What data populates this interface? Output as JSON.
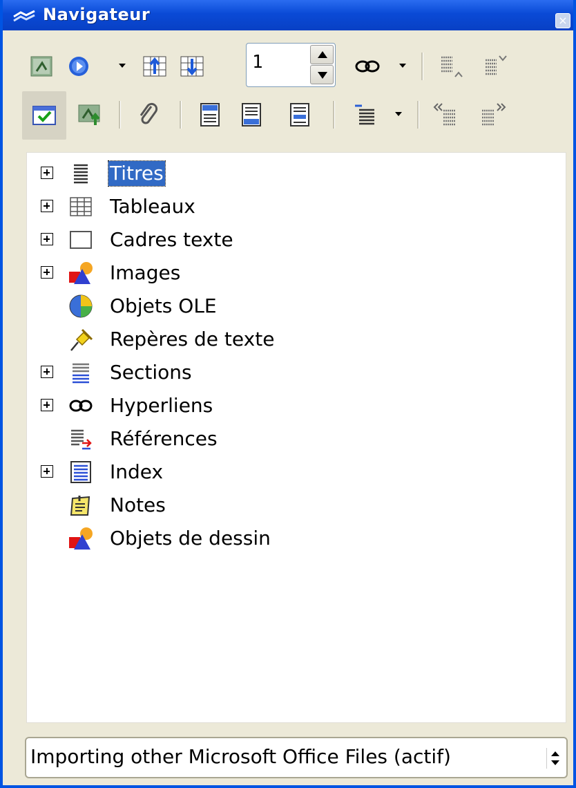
{
  "window": {
    "title": "Navigateur"
  },
  "toolbar": {
    "page_number": "1",
    "row1": [
      {
        "name": "navigation-icon"
      },
      {
        "name": "navigate-icon"
      },
      {
        "name": "previous-icon"
      },
      {
        "name": "next-icon"
      },
      {
        "name": "insert-hyperlink-icon"
      },
      {
        "name": "promote-level-icon"
      },
      {
        "name": "demote-level-icon"
      }
    ],
    "row2": [
      {
        "name": "content-view-toggle-icon"
      },
      {
        "name": "set-reminder-icon"
      },
      {
        "name": "paperclip-icon"
      },
      {
        "name": "header-icon"
      },
      {
        "name": "footer-icon"
      },
      {
        "name": "anchor-icon"
      },
      {
        "name": "heading-levels-icon"
      },
      {
        "name": "promote-chapter-icon"
      },
      {
        "name": "demote-chapter-icon"
      }
    ]
  },
  "tree": {
    "items": [
      {
        "label": "Titres",
        "icon": "headings-icon",
        "expandable": true,
        "selected": true
      },
      {
        "label": "Tableaux",
        "icon": "table-icon",
        "expandable": true
      },
      {
        "label": "Cadres texte",
        "icon": "frame-icon",
        "expandable": true
      },
      {
        "label": "Images",
        "icon": "image-icon",
        "expandable": true
      },
      {
        "label": "Objets OLE",
        "icon": "ole-object-icon",
        "expandable": false
      },
      {
        "label": "Repères de texte",
        "icon": "bookmark-pin-icon",
        "expandable": false
      },
      {
        "label": "Sections",
        "icon": "sections-icon",
        "expandable": true
      },
      {
        "label": "Hyperliens",
        "icon": "hyperlink-icon",
        "expandable": true
      },
      {
        "label": "Références",
        "icon": "references-icon",
        "expandable": false
      },
      {
        "label": "Index",
        "icon": "index-icon",
        "expandable": true
      },
      {
        "label": "Notes",
        "icon": "notes-icon",
        "expandable": false
      },
      {
        "label": "Objets de dessin",
        "icon": "drawing-objects-icon",
        "expandable": false
      }
    ]
  },
  "document_select": {
    "value": "Importing other Microsoft Office Files (actif)"
  },
  "colors": {
    "titlebar": "#0a4ad6",
    "selection": "#316ac5",
    "window_bg": "#ece9d8"
  }
}
